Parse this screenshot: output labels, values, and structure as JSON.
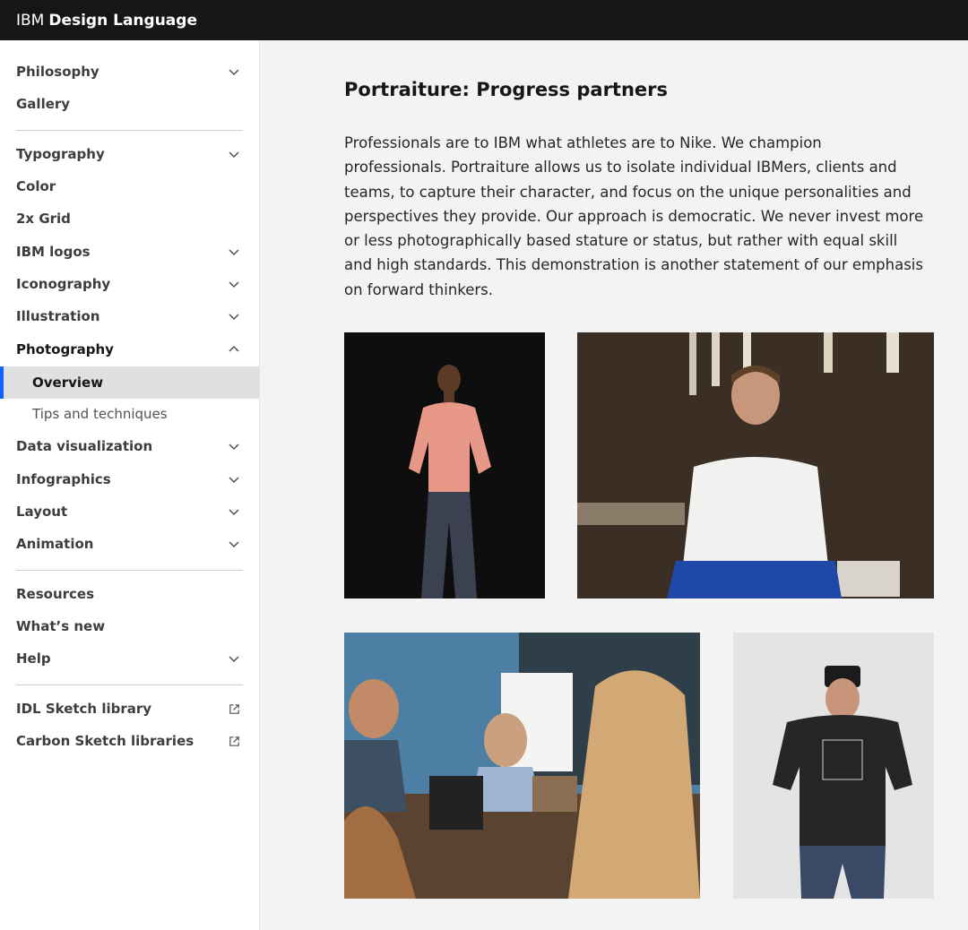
{
  "header": {
    "brand_prefix": "IBM",
    "brand_name": "Design Language"
  },
  "sidebar": {
    "items": [
      {
        "label": "Philosophy",
        "chevron": "down"
      },
      {
        "label": "Gallery"
      },
      {
        "label": "Typography",
        "chevron": "down"
      },
      {
        "label": "Color"
      },
      {
        "label": "2x Grid"
      },
      {
        "label": "IBM logos",
        "chevron": "down"
      },
      {
        "label": "Iconography",
        "chevron": "down"
      },
      {
        "label": "Illustration",
        "chevron": "down"
      },
      {
        "label": "Photography",
        "chevron": "up",
        "expanded": true
      },
      {
        "label": "Overview",
        "sub": true,
        "active": true
      },
      {
        "label": "Tips and techniques",
        "sub": true
      },
      {
        "label": "Data visualization",
        "chevron": "down"
      },
      {
        "label": "Infographics",
        "chevron": "down"
      },
      {
        "label": "Layout",
        "chevron": "down"
      },
      {
        "label": "Animation",
        "chevron": "down"
      },
      {
        "label": "Resources"
      },
      {
        "label": "What’s new"
      },
      {
        "label": "Help",
        "chevron": "down"
      },
      {
        "label": "IDL Sketch library",
        "external": true
      },
      {
        "label": "Carbon Sketch libraries",
        "external": true
      }
    ]
  },
  "main": {
    "title_bold": "Portraiture:",
    "title_rest": "Progress partners",
    "body": "Professionals are to IBM what athletes are to Nike. We champion professionals. Portraiture allows us to isolate individual IBMers, clients and teams, to capture their character, and focus on the unique personalities and perspectives they provide. Our approach is democratic. We never invest more or less photographically based stature or status, but rather with equal skill and high standards. This demonstration is another statement of our emphasis on forward thinkers."
  },
  "colors": {
    "topbar": "#161616",
    "accent": "#0f62fe",
    "active_bg": "#e0e0e0",
    "content_bg": "#f3f3f3"
  }
}
